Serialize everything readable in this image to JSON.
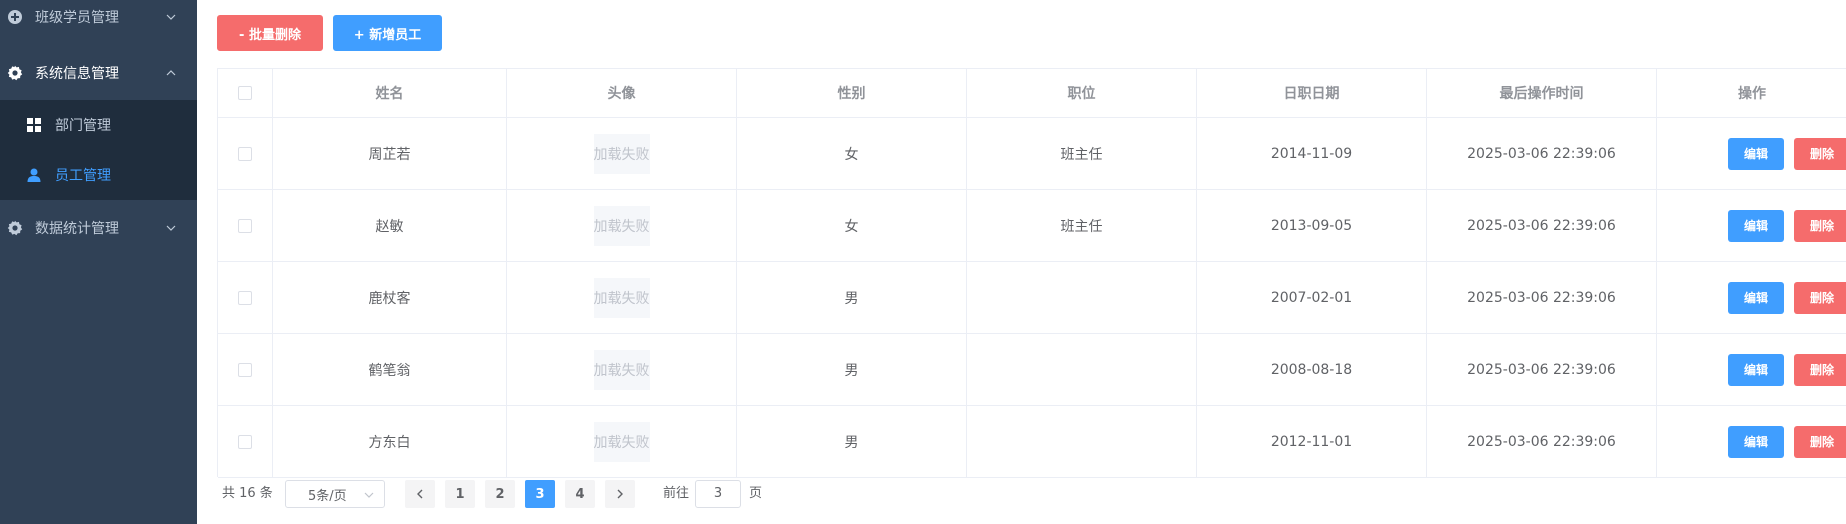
{
  "sidebar": {
    "menus": [
      {
        "label": "班级学员管理",
        "icon": "circle-plus-icon",
        "expanded": false
      },
      {
        "label": "系统信息管理",
        "icon": "gear-icon",
        "expanded": true
      },
      {
        "label": "数据统计管理",
        "icon": "gear-icon",
        "expanded": false
      }
    ],
    "submenu": [
      {
        "label": "部门管理",
        "icon": "grid-icon",
        "active": false
      },
      {
        "label": "员工管理",
        "icon": "user-icon",
        "active": true
      }
    ]
  },
  "toolbar": {
    "batch_delete_label": "- 批量删除",
    "add_employee_label": "+ 新增员工"
  },
  "table": {
    "columns": [
      "姓名",
      "头像",
      "性别",
      "职位",
      "日职日期",
      "最后操作时间",
      "操作"
    ],
    "img_fail_text": "加载失败",
    "edit_label": "编辑",
    "delete_label": "删除",
    "rows": [
      {
        "name": "周芷若",
        "gender": "女",
        "position": "班主任",
        "entry_date": "2014-11-09",
        "update_time": "2025-03-06 22:39:06"
      },
      {
        "name": "赵敏",
        "gender": "女",
        "position": "班主任",
        "entry_date": "2013-09-05",
        "update_time": "2025-03-06 22:39:06"
      },
      {
        "name": "鹿杖客",
        "gender": "男",
        "position": "",
        "entry_date": "2007-02-01",
        "update_time": "2025-03-06 22:39:06"
      },
      {
        "name": "鹤笔翁",
        "gender": "男",
        "position": "",
        "entry_date": "2008-08-18",
        "update_time": "2025-03-06 22:39:06"
      },
      {
        "name": "方东白",
        "gender": "男",
        "position": "",
        "entry_date": "2012-11-01",
        "update_time": "2025-03-06 22:39:06"
      }
    ]
  },
  "pagination": {
    "total_text": "共 16 条",
    "page_size": "5条/页",
    "pages": [
      "1",
      "2",
      "3",
      "4"
    ],
    "current": "3",
    "goto_label": "前往",
    "goto_value": "3",
    "page_suffix": "页"
  },
  "colors": {
    "sidebar_bg": "#304156",
    "submenu_bg": "#1f2d3d",
    "primary": "#409eff",
    "danger": "#f56c6c"
  }
}
